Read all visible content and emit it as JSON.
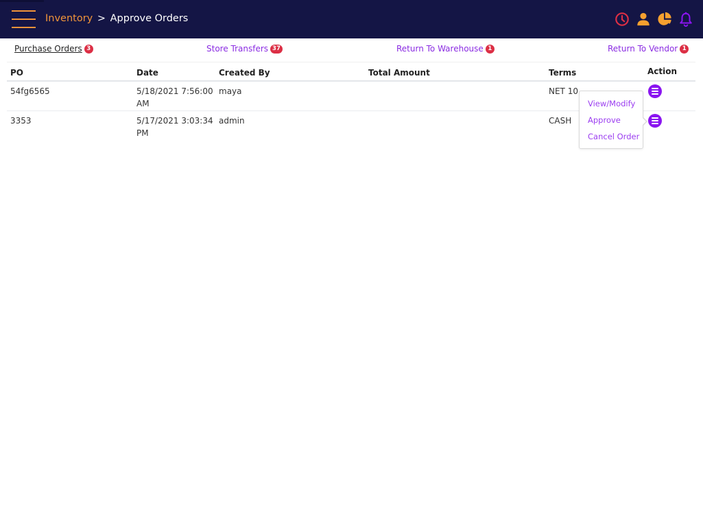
{
  "header": {
    "breadcrumb_parent": "Inventory",
    "breadcrumb_separator": ">",
    "breadcrumb_current": "Approve Orders",
    "icons": [
      "menu-icon",
      "clock-icon",
      "user-icon",
      "pie-chart-icon",
      "bell-icon"
    ],
    "colors": {
      "background": "#141545",
      "accent": "#f0943a",
      "clock": "#dc2f45",
      "bell": "#8a14f0"
    }
  },
  "tabs": [
    {
      "label": "Purchase Orders",
      "badge": "3",
      "active": true
    },
    {
      "label": "Store Transfers",
      "badge": "37",
      "active": false
    },
    {
      "label": "Return To Warehouse",
      "badge": "1",
      "active": false
    },
    {
      "label": "Return To Vendor",
      "badge": "1",
      "active": false
    }
  ],
  "table": {
    "columns": [
      "PO",
      "Date",
      "Created By",
      "Total Amount",
      "Terms",
      "Action"
    ],
    "rows": [
      {
        "po": "54fg6565",
        "date": "5/18/2021 7:56:00 AM",
        "created_by": "maya",
        "total_amount": "",
        "terms": "NET 10"
      },
      {
        "po": "3353",
        "date": "5/17/2021 3:03:34 PM",
        "created_by": "admin",
        "total_amount": "",
        "terms": "CASH"
      }
    ]
  },
  "action_menu": {
    "items": [
      "View/Modify",
      "Approve",
      "Cancel Order"
    ]
  }
}
